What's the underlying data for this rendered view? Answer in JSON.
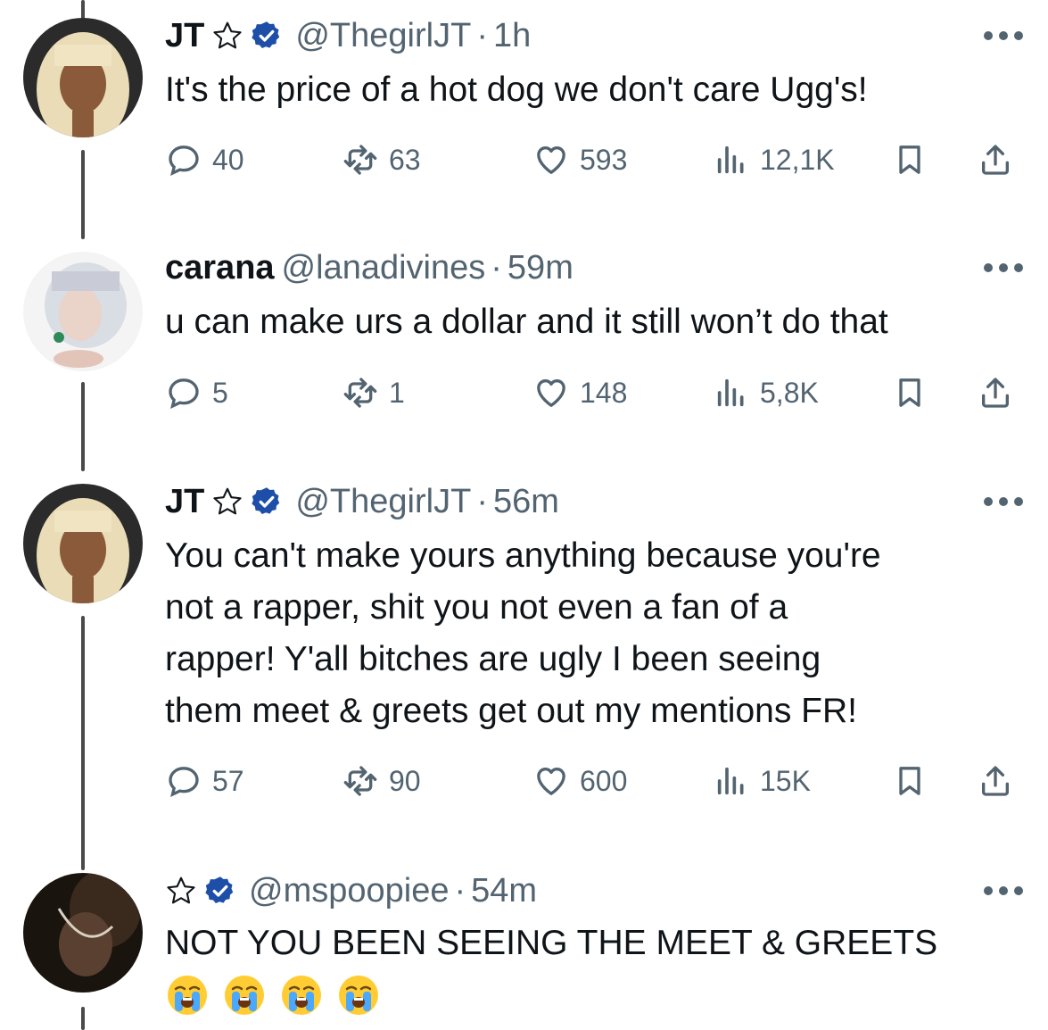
{
  "tweets": [
    {
      "name": "JT",
      "handle": "@ThegirlJT",
      "time": "1h",
      "text": "It's the price of a hot dog we don't care Ugg's!",
      "replies": "40",
      "retweets": "63",
      "likes": "593",
      "views": "12,1K"
    },
    {
      "name": "carana",
      "handle": "@lanadivines",
      "time": "59m",
      "text": "u can make urs a dollar and it still won’t do that",
      "replies": "5",
      "retweets": "1",
      "likes": "148",
      "views": "5,8K"
    },
    {
      "name": "JT",
      "handle": "@ThegirlJT",
      "time": "56m",
      "text_lines": [
        "You can't make yours anything because you're",
        "not a rapper, shit you not even a fan of a",
        "rapper! Y'all bitches are ugly I been seeing",
        "them meet & greets get out my mentions FR!"
      ],
      "replies": "57",
      "retweets": "90",
      "likes": "600",
      "views": "15K"
    },
    {
      "name": "",
      "handle": "@mspoopiee",
      "time": "54m",
      "text": "NOT YOU BEEN SEEING THE MEET & GREETS",
      "emoji": [
        "loudly-crying-face",
        "loudly-crying-face",
        "loudly-crying-face",
        "loudly-crying-face"
      ]
    }
  ],
  "separator": "·",
  "colors": {
    "text": "#0f1419",
    "secondary": "#536471",
    "verified": "#1d9bf0",
    "thread_line": "#4a4a4a"
  }
}
